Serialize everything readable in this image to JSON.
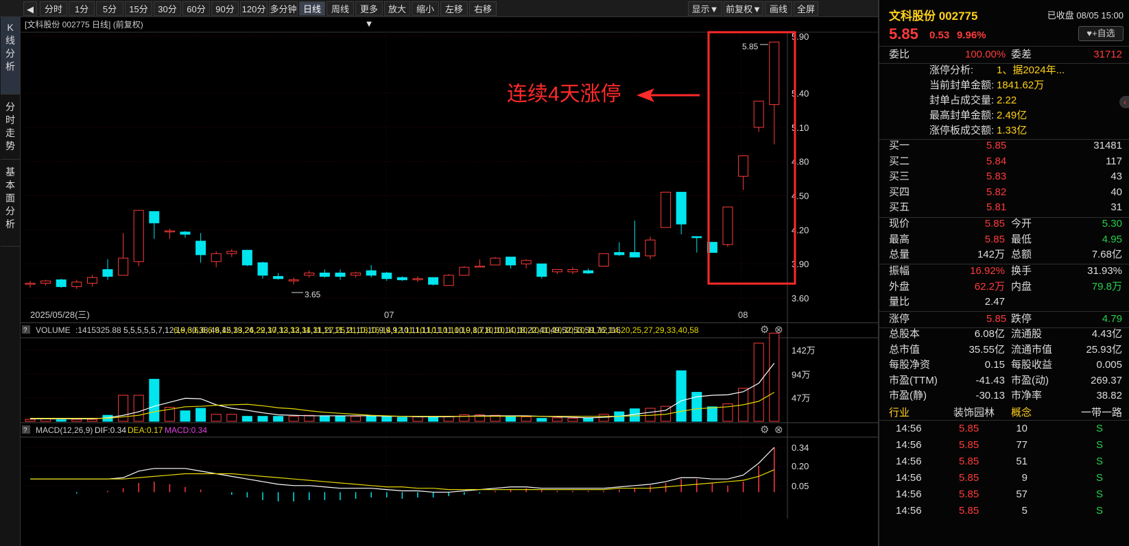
{
  "toolbar": {
    "back_label": "◀",
    "periods": [
      "分时",
      "1分",
      "5分",
      "15分",
      "30分",
      "60分",
      "90分",
      "120分",
      "多分钟",
      "日线",
      "周线",
      "更多▼",
      "放大",
      "缩小",
      "左移",
      "右移"
    ],
    "active_period": "日线",
    "right_buttons": [
      "显示▼",
      "前复权▼",
      "画线",
      "全屏"
    ]
  },
  "side_tabs": [
    {
      "label": "K线分析",
      "active": true
    },
    {
      "label": "分时走势",
      "active": false
    },
    {
      "label": "基本面分析",
      "active": false
    }
  ],
  "kline": {
    "title": "[文科股份 002775 日线]  (前复权)",
    "y_ticks": [
      "5.90",
      "5.40",
      "5.10",
      "4.80",
      "4.50",
      "4.20",
      "3.90",
      "3.60"
    ],
    "x_labels": [
      "2025/05/28(三)",
      "07",
      "08"
    ],
    "low_marker": "3.65",
    "high_marker": "5.85",
    "annotation": "连续4天涨停",
    "candles": [
      {
        "o": 3.72,
        "h": 3.75,
        "l": 3.69,
        "c": 3.73
      },
      {
        "o": 3.73,
        "h": 3.76,
        "l": 3.71,
        "c": 3.75
      },
      {
        "o": 3.76,
        "h": 3.77,
        "l": 3.69,
        "c": 3.7
      },
      {
        "o": 3.7,
        "h": 3.76,
        "l": 3.68,
        "c": 3.74
      },
      {
        "o": 3.73,
        "h": 3.8,
        "l": 3.7,
        "c": 3.78
      },
      {
        "o": 3.85,
        "h": 3.94,
        "l": 3.76,
        "c": 3.79
      },
      {
        "o": 3.8,
        "h": 4.17,
        "l": 3.8,
        "c": 3.95
      },
      {
        "o": 3.92,
        "h": 4.36,
        "l": 3.88,
        "c": 4.37
      },
      {
        "o": 4.36,
        "h": 4.36,
        "l": 4.12,
        "c": 4.26
      },
      {
        "o": 4.19,
        "h": 4.21,
        "l": 4.12,
        "c": 4.19
      },
      {
        "o": 4.18,
        "h": 4.19,
        "l": 4.13,
        "c": 4.16
      },
      {
        "o": 4.1,
        "h": 4.17,
        "l": 3.91,
        "c": 3.98
      },
      {
        "o": 3.92,
        "h": 4.01,
        "l": 3.87,
        "c": 3.99
      },
      {
        "o": 3.99,
        "h": 4.03,
        "l": 3.96,
        "c": 4.01
      },
      {
        "o": 4.02,
        "h": 4.02,
        "l": 3.88,
        "c": 3.89
      },
      {
        "o": 3.91,
        "h": 3.92,
        "l": 3.77,
        "c": 3.8
      },
      {
        "o": 3.79,
        "h": 3.82,
        "l": 3.76,
        "c": 3.77
      },
      {
        "o": 3.75,
        "h": 3.78,
        "l": 3.72,
        "c": 3.76
      },
      {
        "o": 3.8,
        "h": 3.84,
        "l": 3.78,
        "c": 3.82
      },
      {
        "o": 3.82,
        "h": 3.85,
        "l": 3.78,
        "c": 3.79
      },
      {
        "o": 3.82,
        "h": 3.85,
        "l": 3.76,
        "c": 3.79
      },
      {
        "o": 3.8,
        "h": 3.83,
        "l": 3.78,
        "c": 3.82
      },
      {
        "o": 3.84,
        "h": 3.89,
        "l": 3.78,
        "c": 3.8
      },
      {
        "o": 3.82,
        "h": 3.83,
        "l": 3.75,
        "c": 3.77
      },
      {
        "o": 3.78,
        "h": 3.79,
        "l": 3.75,
        "c": 3.76
      },
      {
        "o": 3.77,
        "h": 3.79,
        "l": 3.74,
        "c": 3.77
      },
      {
        "o": 3.78,
        "h": 3.78,
        "l": 3.71,
        "c": 3.72
      },
      {
        "o": 3.71,
        "h": 3.81,
        "l": 3.71,
        "c": 3.8
      },
      {
        "o": 3.8,
        "h": 3.88,
        "l": 3.8,
        "c": 3.87
      },
      {
        "o": 3.88,
        "h": 3.94,
        "l": 3.87,
        "c": 3.88
      },
      {
        "o": 3.89,
        "h": 3.96,
        "l": 3.89,
        "c": 3.95
      },
      {
        "o": 3.96,
        "h": 3.96,
        "l": 3.86,
        "c": 3.89
      },
      {
        "o": 3.9,
        "h": 3.94,
        "l": 3.86,
        "c": 3.93
      },
      {
        "o": 3.9,
        "h": 3.9,
        "l": 3.77,
        "c": 3.79
      },
      {
        "o": 3.83,
        "h": 3.85,
        "l": 3.81,
        "c": 3.85
      },
      {
        "o": 3.83,
        "h": 3.87,
        "l": 3.81,
        "c": 3.85
      },
      {
        "o": 3.84,
        "h": 3.86,
        "l": 3.81,
        "c": 3.82
      },
      {
        "o": 3.88,
        "h": 3.99,
        "l": 3.88,
        "c": 3.99
      },
      {
        "o": 4.0,
        "h": 4.09,
        "l": 3.97,
        "c": 3.98
      },
      {
        "o": 4.0,
        "h": 4.28,
        "l": 3.96,
        "c": 3.96
      },
      {
        "o": 3.97,
        "h": 4.14,
        "l": 3.94,
        "c": 4.11
      },
      {
        "o": 4.22,
        "h": 4.53,
        "l": 4.22,
        "c": 4.53
      },
      {
        "o": 4.53,
        "h": 4.53,
        "l": 4.16,
        "c": 4.25
      },
      {
        "o": 4.14,
        "h": 4.14,
        "l": 4.0,
        "c": 4.13
      },
      {
        "o": 4.09,
        "h": 4.09,
        "l": 4.0,
        "c": 4.0
      },
      {
        "o": 4.07,
        "h": 4.4,
        "l": 4.05,
        "c": 4.4
      },
      {
        "o": 4.67,
        "h": 4.85,
        "l": 4.55,
        "c": 4.85
      },
      {
        "o": 5.1,
        "h": 5.33,
        "l": 5.06,
        "c": 5.33
      },
      {
        "o": 5.3,
        "h": 5.85,
        "l": 4.95,
        "c": 5.85
      }
    ]
  },
  "volume": {
    "label": "VOLUME",
    "value": ":1415325.88",
    "ma5": [
      5,
      5,
      5,
      5,
      5,
      7,
      12,
      19,
      30,
      38,
      46,
      45,
      33,
      26,
      22,
      17,
      13,
      12,
      11,
      11,
      11,
      11,
      11,
      10,
      10,
      9,
      9,
      9,
      10,
      11,
      11,
      11,
      11,
      10,
      9,
      8,
      7,
      8,
      10,
      14,
      18,
      22,
      41,
      49,
      52,
      53,
      59,
      76,
      116
    ],
    "ma10": [
      6,
      6,
      6,
      6,
      6,
      6,
      9,
      12,
      19,
      24,
      29,
      30,
      32,
      33,
      34,
      31,
      27,
      25,
      21,
      18,
      16,
      14,
      12,
      11,
      10,
      10,
      10,
      10,
      10,
      10,
      10,
      10,
      10,
      10,
      10,
      10,
      10,
      10,
      10,
      11,
      12,
      14,
      20,
      25,
      27,
      29,
      33,
      40,
      58
    ],
    "y_ticks": [
      "142万",
      "94万",
      "47万"
    ],
    "bars": [
      4,
      5,
      3,
      4,
      4,
      12,
      52,
      52,
      84,
      28,
      21,
      26,
      14,
      14,
      10,
      10,
      10,
      10,
      12,
      11,
      10,
      10,
      10,
      9,
      8,
      9,
      9,
      10,
      13,
      13,
      12,
      10,
      9,
      6,
      7,
      6,
      7,
      14,
      19,
      25,
      26,
      30,
      101,
      58,
      29,
      35,
      66,
      156,
      176
    ]
  },
  "macd": {
    "label": "MACD(12,26,9)",
    "dif": "DIF:0.34",
    "dea": "DEA:0.17",
    "macd": "MACD:0.34",
    "y_ticks": [
      "0.34",
      "0.20",
      "0.05"
    ],
    "dif_line": [
      0.1,
      0.1,
      0.1,
      0.1,
      0.1,
      0.1,
      0.11,
      0.16,
      0.18,
      0.18,
      0.18,
      0.16,
      0.14,
      0.12,
      0.1,
      0.08,
      0.06,
      0.05,
      0.05,
      0.04,
      0.03,
      0.03,
      0.03,
      0.02,
      0.01,
      0.01,
      0.0,
      0.0,
      0.01,
      0.02,
      0.03,
      0.04,
      0.04,
      0.03,
      0.03,
      0.03,
      0.03,
      0.03,
      0.04,
      0.05,
      0.06,
      0.08,
      0.11,
      0.11,
      0.1,
      0.1,
      0.13,
      0.22,
      0.34
    ],
    "dea_line": [
      0.1,
      0.1,
      0.1,
      0.1,
      0.1,
      0.1,
      0.1,
      0.11,
      0.12,
      0.13,
      0.14,
      0.14,
      0.14,
      0.14,
      0.13,
      0.12,
      0.11,
      0.1,
      0.09,
      0.08,
      0.07,
      0.06,
      0.05,
      0.04,
      0.04,
      0.03,
      0.03,
      0.02,
      0.02,
      0.02,
      0.02,
      0.02,
      0.02,
      0.02,
      0.02,
      0.02,
      0.02,
      0.02,
      0.03,
      0.03,
      0.03,
      0.04,
      0.05,
      0.06,
      0.07,
      0.08,
      0.09,
      0.12,
      0.17
    ],
    "hist": [
      0.0,
      0.0,
      0.0,
      -0.01,
      0.0,
      0.01,
      0.03,
      0.07,
      0.08,
      0.06,
      0.04,
      0.02,
      0.0,
      -0.02,
      -0.04,
      -0.06,
      -0.07,
      -0.07,
      -0.06,
      -0.06,
      -0.06,
      -0.05,
      -0.04,
      -0.04,
      -0.05,
      -0.04,
      -0.04,
      -0.03,
      -0.02,
      -0.01,
      0.01,
      0.02,
      0.03,
      0.02,
      0.01,
      0.01,
      0.01,
      0.01,
      0.02,
      0.03,
      0.05,
      0.07,
      0.1,
      0.1,
      0.07,
      0.05,
      0.08,
      0.2,
      0.34
    ]
  },
  "quote": {
    "name": "文科股份 002775",
    "status": "已收盘 08/05 15:00",
    "price": "5.85",
    "change": "0.53",
    "pct": "9.96%",
    "watch_label": "+自选",
    "wb_label": "委比",
    "wb_value": "100.00%",
    "wc_label": "委差",
    "wc_value": "31712",
    "limit_info": [
      {
        "label": "涨停分析:",
        "value": "1、据2024年..."
      },
      {
        "label": "当前封单金额:",
        "value": "1841.62万"
      },
      {
        "label": "封单占成交量:",
        "value": "2.22"
      },
      {
        "label": "最高封单金额:",
        "value": "2.49亿"
      },
      {
        "label": "涨停板成交额:",
        "value": "1.33亿"
      }
    ],
    "bids": [
      {
        "label": "买一",
        "price": "5.85",
        "vol": "31481"
      },
      {
        "label": "买二",
        "price": "5.84",
        "vol": "117"
      },
      {
        "label": "买三",
        "price": "5.83",
        "vol": "43"
      },
      {
        "label": "买四",
        "price": "5.82",
        "vol": "40"
      },
      {
        "label": "买五",
        "price": "5.81",
        "vol": "31"
      }
    ],
    "stats": [
      {
        "l1": "现价",
        "v1": "5.85",
        "c1": "red",
        "l2": "今开",
        "v2": "5.30",
        "c2": "green"
      },
      {
        "l1": "最高",
        "v1": "5.85",
        "c1": "red",
        "l2": "最低",
        "v2": "4.95",
        "c2": "green"
      },
      {
        "l1": "总量",
        "v1": "142万",
        "c1": "white",
        "l2": "总额",
        "v2": "7.68亿",
        "c2": "white"
      }
    ],
    "stats2": [
      {
        "l1": "振幅",
        "v1": "16.92%",
        "c1": "red",
        "l2": "换手",
        "v2": "31.93%",
        "c2": "white"
      },
      {
        "l1": "外盘",
        "v1": "62.2万",
        "c1": "red",
        "l2": "内盘",
        "v2": "79.8万",
        "c2": "green"
      },
      {
        "l1": "量比",
        "v1": "2.47",
        "c1": "white",
        "l2": "",
        "v2": "",
        "c2": "white"
      }
    ],
    "limits": {
      "up_label": "涨停",
      "up": "5.85",
      "down_label": "跌停",
      "down": "4.79"
    },
    "fundamentals": [
      {
        "l1": "总股本",
        "v1": "6.08亿",
        "l2": "流通股",
        "v2": "4.43亿"
      },
      {
        "l1": "总市值",
        "v1": "35.55亿",
        "l2": "流通市值",
        "v2": "25.93亿"
      },
      {
        "l1": "每股净资",
        "v1": "0.15",
        "l2": "每股收益",
        "v2": "0.005"
      },
      {
        "l1": "市盈(TTM)",
        "v1": "-41.43",
        "l2": "市盈(动)",
        "v2": "269.37"
      },
      {
        "l1": "市盈(静)",
        "v1": "-30.13",
        "l2": "市净率",
        "v2": "38.82"
      }
    ],
    "industry": {
      "l1": "行业",
      "v1": "装饰园林",
      "l2": "概念",
      "v2": "一带一路"
    },
    "ticks": [
      {
        "time": "14:56",
        "price": "5.85",
        "vol": "10",
        "side": "S"
      },
      {
        "time": "14:56",
        "price": "5.85",
        "vol": "77",
        "side": "S"
      },
      {
        "time": "14:56",
        "price": "5.85",
        "vol": "51",
        "side": "S"
      },
      {
        "time": "14:56",
        "price": "5.85",
        "vol": "9",
        "side": "S"
      },
      {
        "time": "14:56",
        "price": "5.85",
        "vol": "57",
        "side": "S"
      },
      {
        "time": "14:56",
        "price": "5.85",
        "vol": "5",
        "side": "S"
      }
    ]
  },
  "colors": {
    "up": "#ff3b3b",
    "down": "#00e5ee",
    "ma5": "#ffffff",
    "ma10": "#e8d900",
    "macd_pos": "#ff3b3b",
    "macd_neg": "#00e5ee",
    "grid": "#3a0000"
  }
}
